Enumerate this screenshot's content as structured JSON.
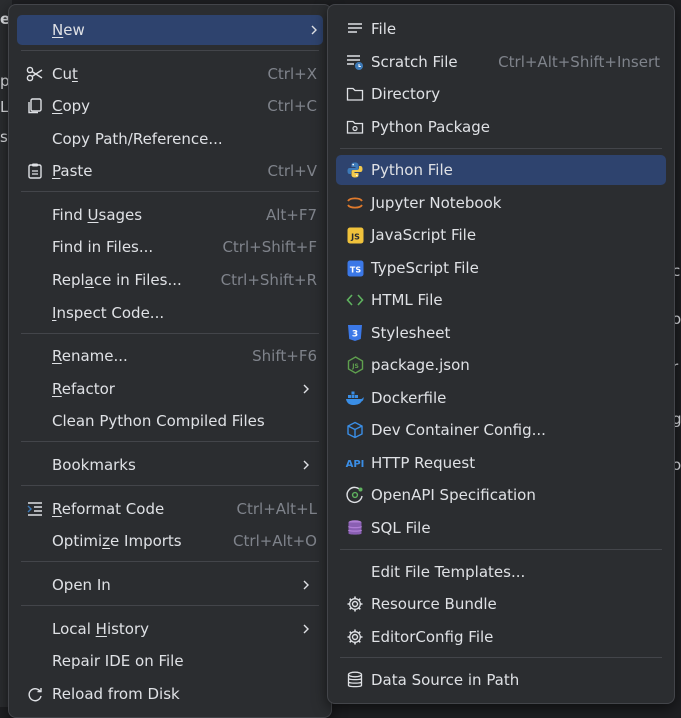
{
  "context_menu": {
    "items": [
      {
        "label": "New",
        "underline": "N",
        "shortcut": "",
        "submenu": true,
        "icon": ""
      },
      {
        "label": "Cut",
        "underline": "t",
        "shortcut": "Ctrl+X",
        "icon": "scissors-icon"
      },
      {
        "label": "Copy",
        "underline": "C",
        "shortcut": "Ctrl+C",
        "icon": "copy-icon"
      },
      {
        "label": "Copy Path/Reference...",
        "shortcut": "",
        "icon": ""
      },
      {
        "label": "Paste",
        "underline": "P",
        "shortcut": "Ctrl+V",
        "icon": "paste-icon"
      },
      {
        "label": "Find Usages",
        "underline": "U",
        "shortcut": "Alt+F7",
        "icon": ""
      },
      {
        "label": "Find in Files...",
        "shortcut": "Ctrl+Shift+F",
        "icon": ""
      },
      {
        "label": "Replace in Files...",
        "underline": "a",
        "shortcut": "Ctrl+Shift+R",
        "icon": ""
      },
      {
        "label": "Inspect Code...",
        "underline": "I",
        "shortcut": "",
        "icon": ""
      },
      {
        "label": "Rename...",
        "underline": "R",
        "shortcut": "Shift+F6",
        "icon": ""
      },
      {
        "label": "Refactor",
        "underline": "R",
        "shortcut": "",
        "submenu": true,
        "icon": ""
      },
      {
        "label": "Clean Python Compiled Files",
        "shortcut": "",
        "icon": ""
      },
      {
        "label": "Bookmarks",
        "shortcut": "",
        "submenu": true,
        "icon": ""
      },
      {
        "label": "Reformat Code",
        "underline": "R",
        "shortcut": "Ctrl+Alt+L",
        "icon": "reformat-icon"
      },
      {
        "label": "Optimize Imports",
        "underline": "z",
        "shortcut": "Ctrl+Alt+O",
        "icon": ""
      },
      {
        "label": "Open In",
        "shortcut": "",
        "submenu": true,
        "icon": ""
      },
      {
        "label": "Local History",
        "underline": "H",
        "shortcut": "",
        "submenu": true,
        "icon": ""
      },
      {
        "label": "Repair IDE on File",
        "shortcut": "",
        "icon": ""
      },
      {
        "label": "Reload from Disk",
        "shortcut": "",
        "icon": "reload-icon"
      }
    ]
  },
  "new_submenu": {
    "items": [
      {
        "label": "File",
        "shortcut": "",
        "icon": "file-icon"
      },
      {
        "label": "Scratch File",
        "shortcut": "Ctrl+Alt+Shift+Insert",
        "icon": "scratch-file-icon"
      },
      {
        "label": "Directory",
        "shortcut": "",
        "icon": "folder-icon"
      },
      {
        "label": "Python Package",
        "shortcut": "",
        "icon": "package-icon"
      },
      {
        "label": "Python File",
        "shortcut": "",
        "icon": "python-icon"
      },
      {
        "label": "Jupyter Notebook",
        "shortcut": "",
        "icon": "jupyter-icon"
      },
      {
        "label": "JavaScript File",
        "shortcut": "",
        "icon": "javascript-icon",
        "badge": "JS"
      },
      {
        "label": "TypeScript File",
        "shortcut": "",
        "icon": "typescript-icon",
        "badge": "TS"
      },
      {
        "label": "HTML File",
        "shortcut": "",
        "icon": "html-icon"
      },
      {
        "label": "Stylesheet",
        "shortcut": "",
        "icon": "css-icon",
        "badge": "3"
      },
      {
        "label": "package.json",
        "shortcut": "",
        "icon": "nodejs-icon",
        "badge": "JS"
      },
      {
        "label": "Dockerfile",
        "shortcut": "",
        "icon": "docker-icon"
      },
      {
        "label": "Dev Container Config...",
        "shortcut": "",
        "icon": "dev-container-icon"
      },
      {
        "label": "HTTP Request",
        "shortcut": "",
        "icon": "api-icon",
        "badge": "API"
      },
      {
        "label": "OpenAPI Specification",
        "shortcut": "",
        "icon": "openapi-icon"
      },
      {
        "label": "SQL File",
        "shortcut": "",
        "icon": "database-icon"
      },
      {
        "label": "Edit File Templates...",
        "shortcut": "",
        "icon": ""
      },
      {
        "label": "Resource Bundle",
        "shortcut": "",
        "icon": "gear-icon"
      },
      {
        "label": "EditorConfig File",
        "shortcut": "",
        "icon": "gear-icon"
      },
      {
        "label": "Data Source in Path",
        "shortcut": "",
        "icon": "database-icon"
      }
    ]
  },
  "background": {
    "left_chars": [
      "e",
      "p",
      "L",
      "s"
    ],
    "right_chars": [
      "c",
      "o",
      "r",
      "g",
      "o"
    ]
  },
  "colors": {
    "menu_bg": "#2b2d30",
    "highlight": "#2e436e",
    "separator": "#43454a",
    "text": "#dfe1e5",
    "shortcut": "#7f838b",
    "python_blue": "#3d7ab8",
    "python_yellow": "#f2c94c",
    "js_yellow": "#f0c23b",
    "ts_blue": "#3b78e7",
    "html_green": "#5fb25f",
    "node_green": "#5fa04e",
    "docker_blue": "#3a8ee6",
    "jupyter_orange": "#e07a2c"
  }
}
